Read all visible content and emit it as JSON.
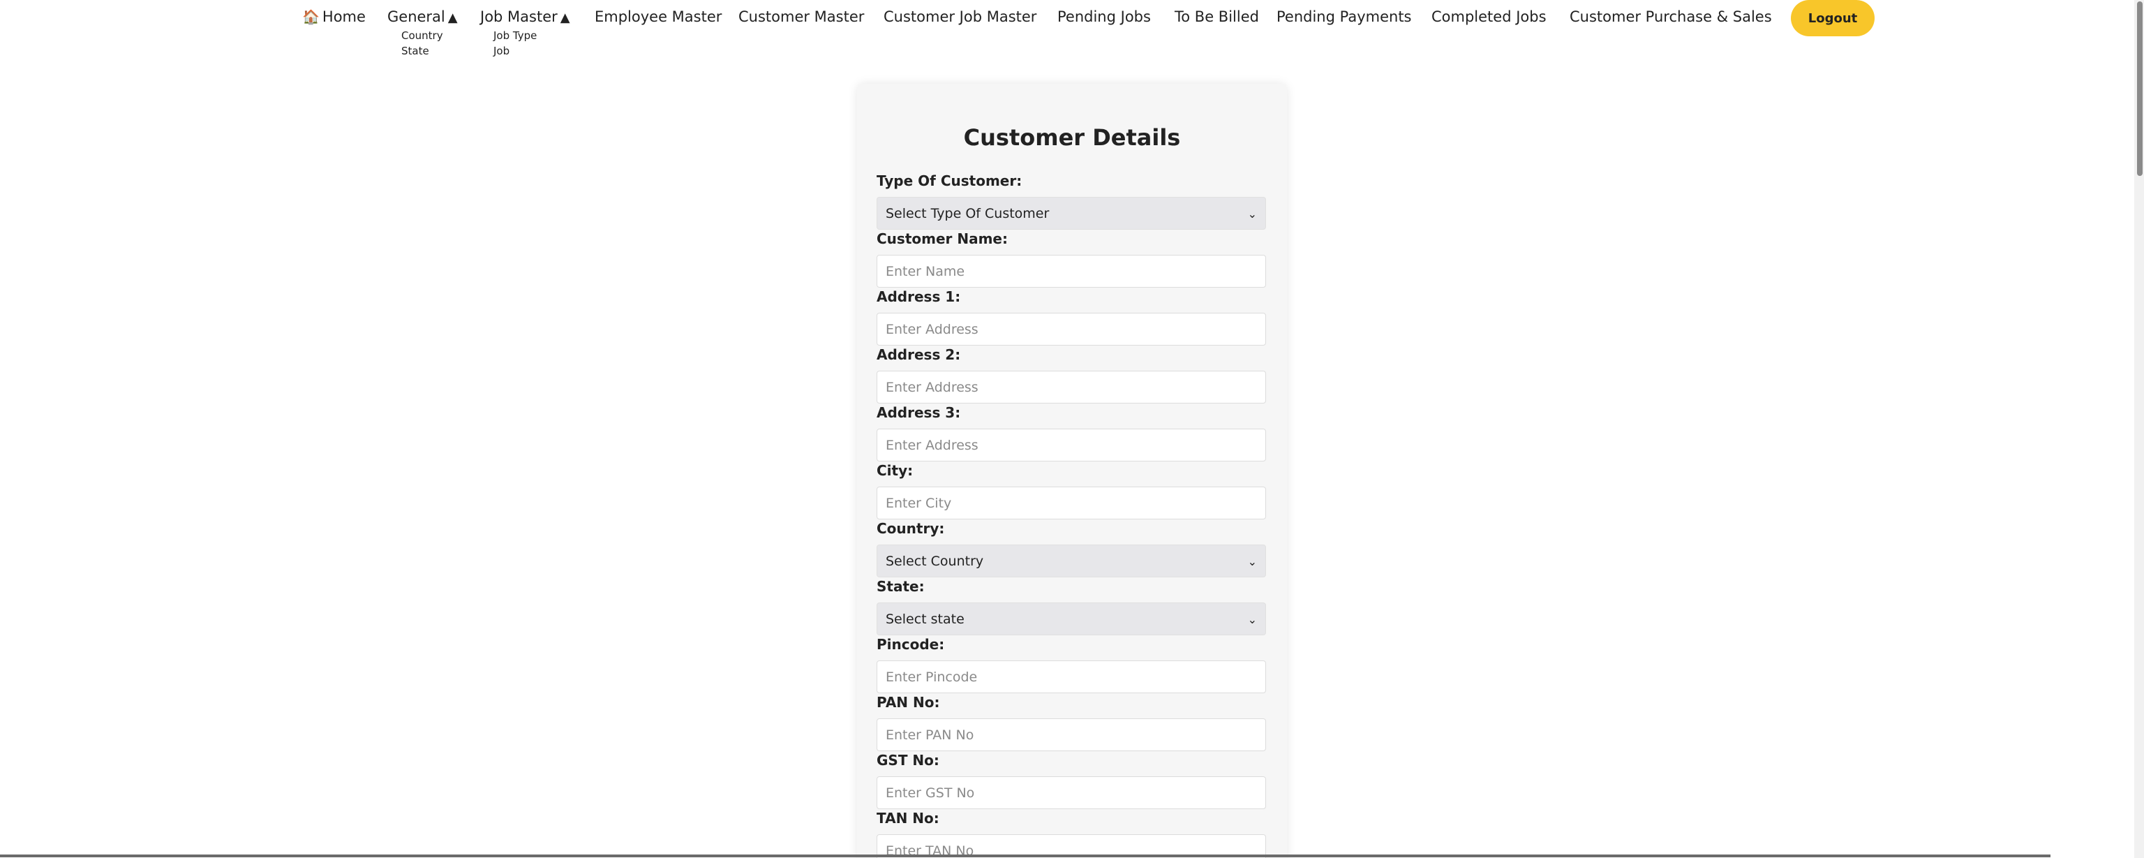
{
  "nav": {
    "home_icon": "house-icon",
    "home_label": "Home",
    "general_label": "General",
    "jobmaster_label": "Job Master",
    "caret_glyph": "▲",
    "employee_label": "Employee Master",
    "customer_label": "Customer Master",
    "customer_job_label": "Customer Job Master",
    "pending_jobs_label": "Pending Jobs",
    "to_be_billed_label": "To Be Billed",
    "pending_payments_label": "Pending Payments",
    "completed_jobs_label": "Completed Jobs",
    "purchase_sales_label": "Customer Purchase & Sales",
    "logout_label": "Logout",
    "general_submenu": [
      "Country",
      "State"
    ],
    "jobmaster_submenu": [
      "Job Type",
      "Job"
    ]
  },
  "colors": {
    "logout_bg": "#f8c62a",
    "card_bg": "#f6f6f6",
    "select_bg": "#e7e7ea"
  },
  "form": {
    "title": "Customer Details",
    "type_of_customer": {
      "label": "Type Of Customer:",
      "value": "Select Type Of Customer"
    },
    "customer_name": {
      "label": "Customer Name:",
      "placeholder": "Enter Name"
    },
    "address1": {
      "label": "Address 1:",
      "placeholder": "Enter Address"
    },
    "address2": {
      "label": "Address 2:",
      "placeholder": "Enter Address"
    },
    "address3": {
      "label": "Address 3:",
      "placeholder": "Enter Address"
    },
    "city": {
      "label": "City:",
      "placeholder": "Enter City"
    },
    "country": {
      "label": "Country:",
      "value": "Select Country"
    },
    "state": {
      "label": "State:",
      "value": "Select state"
    },
    "pincode": {
      "label": "Pincode:",
      "placeholder": "Enter Pincode"
    },
    "pan": {
      "label": "PAN No:",
      "placeholder": "Enter PAN No"
    },
    "gst": {
      "label": "GST No:",
      "placeholder": "Enter GST No"
    },
    "tan": {
      "label": "TAN No:",
      "placeholder": "Enter TAN No"
    }
  }
}
